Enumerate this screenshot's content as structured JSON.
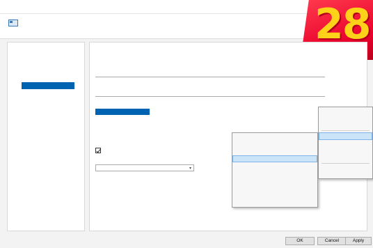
{
  "window": {
    "title": ""
  },
  "header": {
    "profile_name": "",
    "profile_subtitle": ""
  },
  "badge": {
    "text": "28"
  },
  "sidebar": {
    "title": "",
    "items": [
      {
        "label": "",
        "level": 1
      },
      {
        "label": "",
        "level": 1
      },
      {
        "label": "",
        "level": 1
      },
      {
        "label": "",
        "level": 1
      },
      {
        "label": "",
        "level": 2,
        "selected": true
      },
      {
        "label": "",
        "level": 3
      },
      {
        "label": "",
        "level": 2
      },
      {
        "label": "",
        "level": 1
      },
      {
        "label": "",
        "level": 2
      },
      {
        "label": "",
        "level": 2
      },
      {
        "label": "",
        "level": 2
      },
      {
        "label": "",
        "level": 1
      },
      {
        "label": "",
        "level": 2
      },
      {
        "label": "",
        "level": 3
      },
      {
        "label": "",
        "level": 1
      },
      {
        "label": "",
        "level": 1
      },
      {
        "label": "",
        "level": 1
      }
    ]
  },
  "main": {
    "title": "",
    "group_title": "",
    "folder": {
      "label": "",
      "value": ""
    },
    "subfolder": {
      "label": "",
      "value": ""
    },
    "filename": {
      "label": "",
      "value": "",
      "link": ""
    },
    "link": "",
    "note": "",
    "checkbox_label": "",
    "select_label": "",
    "select_value": ""
  },
  "menu_primary": {
    "items": [
      {
        "label": ""
      },
      {
        "label": ""
      },
      {
        "label": ""
      },
      {
        "label": "",
        "highlight": true
      },
      {
        "label": ""
      },
      {
        "label": ""
      },
      {
        "label": ""
      },
      {
        "label": ""
      },
      {
        "label": ""
      }
    ]
  },
  "menu_secondary": {
    "items": [
      {
        "label": ""
      },
      {
        "label": ""
      },
      {
        "label": ""
      },
      {
        "label": "",
        "highlight": true
      },
      {
        "label": ""
      },
      {
        "label": ""
      },
      {
        "label": ""
      },
      {
        "label": ""
      }
    ]
  },
  "buttons": {
    "ok": "OK",
    "cancel": "Cancel",
    "apply": "Apply"
  },
  "colors": {
    "accent": "#0063b1",
    "badge_red": "#e8002a",
    "badge_yellow": "#ffd21a"
  }
}
